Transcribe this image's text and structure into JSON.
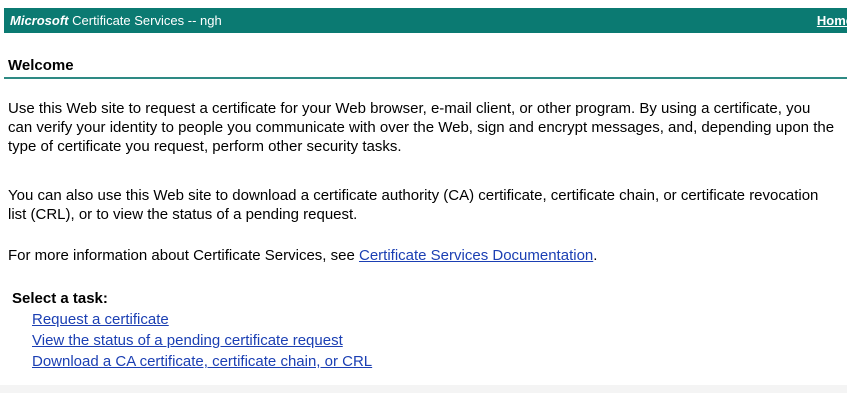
{
  "header": {
    "brand": "Microsoft",
    "title": "Certificate Services",
    "separator": "--",
    "server": "ngh",
    "home_link": "Home",
    "background_color": "#0b7a72"
  },
  "welcome": {
    "heading": "Welcome"
  },
  "body": {
    "paragraph1": "Use this Web site to request a certificate for your Web browser, e-mail client, or other program. By using a certificate, you can verify your identity to people you communicate with over the Web, sign and encrypt messages, and, depending upon the type of certificate you request, perform other security tasks.",
    "paragraph2": "You can also use this Web site to download a certificate authority (CA) certificate, certificate chain, or certificate revocation list (CRL), or to view the status of a pending request.",
    "paragraph3_prefix": "For more information about Certificate Services, see ",
    "documentation_link": "Certificate Services Documentation",
    "paragraph3_suffix": "."
  },
  "tasks": {
    "heading": "Select a task:",
    "items": [
      {
        "label": "Request a certificate"
      },
      {
        "label": "View the status of a pending certificate request"
      },
      {
        "label": "Download a CA certificate, certificate chain, or CRL"
      }
    ]
  },
  "colors": {
    "link": "#1b3fb3",
    "rule": "#2e8a84"
  }
}
